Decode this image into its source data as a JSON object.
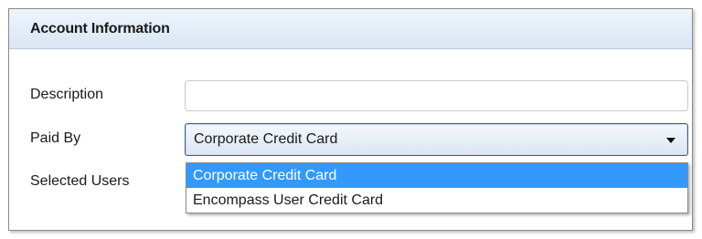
{
  "panel": {
    "title": "Account Information"
  },
  "form": {
    "description_label": "Description",
    "description_value": "",
    "paid_by_label": "Paid By",
    "paid_by_value": "Corporate Credit Card",
    "selected_users_label": "Selected Users"
  },
  "dropdown": {
    "options": [
      {
        "label": "Corporate Credit Card",
        "selected": true
      },
      {
        "label": "Encompass User Credit Card",
        "selected": false
      }
    ],
    "selected_color": "#3399ff"
  },
  "icons": {
    "select_arrow": "chevron-down-icon"
  }
}
